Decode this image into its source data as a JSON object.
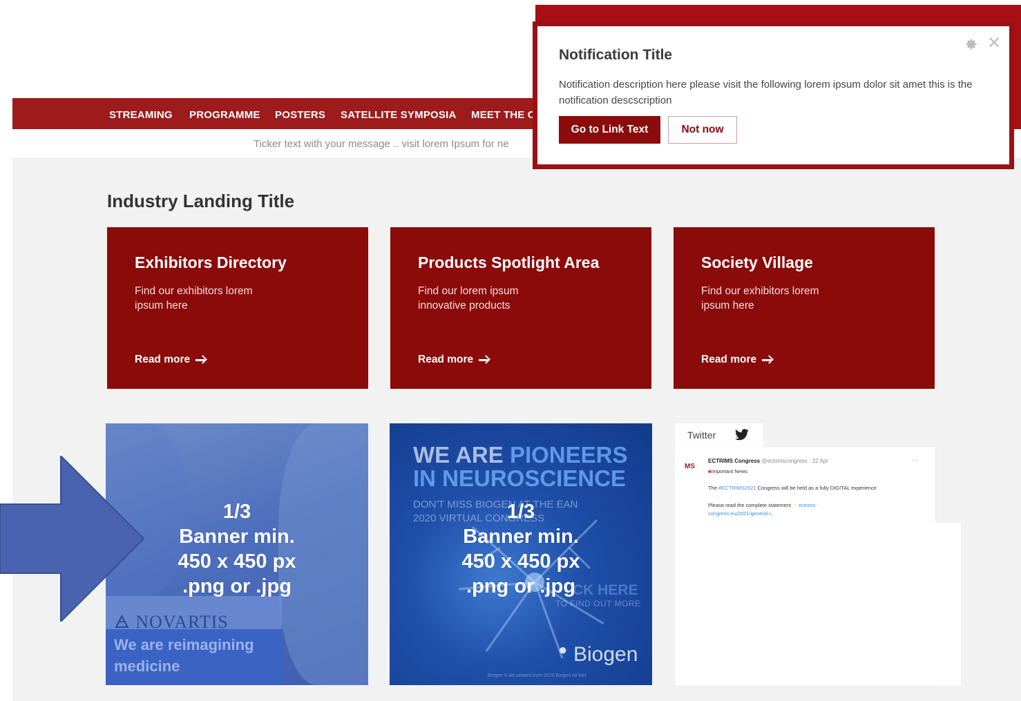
{
  "nav": {
    "items": [
      "STREAMING",
      "PROGRAMME",
      "POSTERS",
      "SATELLITE SYMPOSIA",
      "MEET THE C"
    ]
  },
  "ticker": {
    "text": "Ticker text with your message .. visit lorem Ipsum  for ne"
  },
  "landing": {
    "title": "Industry Landing Title"
  },
  "tiles": [
    {
      "title": "Exhibitors Directory",
      "description": "Find our exhibitors lorem ipsum here",
      "link": "Read more"
    },
    {
      "title": "Products Spotlight Area",
      "description": "Find our lorem ipsum innovative products",
      "link": "Read more"
    },
    {
      "title": "Society Village",
      "description": "Find our exhibitors lorem ipsum here",
      "link": "Read more"
    }
  ],
  "banners": [
    {
      "counter": "1/3",
      "lines": [
        "Banner min.",
        "450 x 450 px",
        ".png or .jpg"
      ],
      "brand": "NOVARTIS",
      "tagline": "We are reimagining medicine"
    },
    {
      "counter": "1/3",
      "lines": [
        "Banner min.",
        "450 x 450 px",
        ".png or .jpg"
      ],
      "headline_1a": "WE ARE ",
      "headline_1b": "PIONEERS",
      "headline_2": "IN NEUROSCIENCE",
      "sub": "DON'T MISS BIOGEN AT THE EAN 2020 VIRTUAL CONGRESS",
      "cta": "CK HERE",
      "cta_sub": "TO FIND OUT MORE",
      "brand": "Biogen",
      "fine_print": "Biogen © All content from 2020 Biogen All Ref"
    }
  ],
  "twitter": {
    "label": "Twitter",
    "avatar": "MS",
    "author": "ECTRIMS Congress",
    "handle": " @ectrimscongress · 22 Apr",
    "line1": "Important News",
    "line2_a": "The ",
    "line2_link": "#ECTRIMS2021",
    "line2_b": " Congress will be held as a fully DIGITAL experience",
    "line3_a": "Please read the complete statement ",
    "line3_link": "ectrims-",
    "line4_link": "congress.eu/2021/general-i...",
    "more": "···"
  },
  "notification": {
    "title": "Notification Title",
    "description": "Notification description here please visit the following lorem ipsum dolor sit amet this is the notification descscription",
    "primary_button": "Go to Link Text",
    "secondary_button": "Not now"
  },
  "colors": {
    "brand_red": "#9e1b1b",
    "tile_red": "#8b0a0a",
    "arrow_blue": "#4a63b0"
  }
}
